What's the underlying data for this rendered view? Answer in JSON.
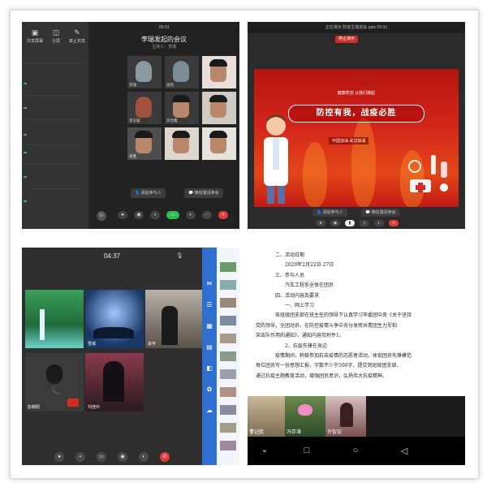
{
  "panel1": {
    "toolbar": [
      {
        "label": "共享屏幕"
      },
      {
        "label": "分屏"
      },
      {
        "label": "禁止共享"
      }
    ],
    "time": "05:03",
    "meeting_title": "李瑞发起的会议",
    "meeting_sub": "主持人：李瑞",
    "participants": [
      {
        "name": "李瑞"
      },
      {
        "name": "张凯"
      },
      {
        "name": "陈子良"
      },
      {
        "name": "李玉璇"
      },
      {
        "name": "邓佳鑫"
      },
      {
        "name": "王浩"
      },
      {
        "name": "黄鑫"
      },
      {
        "name": "刘阳"
      },
      {
        "name": "张宇"
      }
    ],
    "add_participant_label": "添加参与人",
    "invite_label": "微信邀请参会"
  },
  "panel2": {
    "window_title": "正在演示 防疫主题班会.pptx 05:03",
    "tag": "停止演示",
    "slogan_top": "健康防范 从我们做起",
    "headline": "防控有我，战疫必胜",
    "footer_text": "中国加油 武汉加油",
    "add_participant_label": "添加参与人",
    "invite_label": "微信邀请参会"
  },
  "panel3": {
    "time": "04:37",
    "tiles": [
      {
        "name": "",
        "color": "#2f8a4c"
      },
      {
        "name": "雪域",
        "color": "#1d3a6a"
      },
      {
        "name": "肖宇",
        "color": "#5a5148"
      },
      {
        "name": "彭朝阳",
        "color": "#3a3a3a"
      },
      {
        "name": "刘佳玲",
        "color": "#4a2a3a"
      }
    ]
  },
  "panel4": {
    "lines": [
      "二、活动日期",
      "2020年2月22日-27日",
      "三、参与人员",
      "汽车工程系全体在团员",
      "四、活动内容及要求",
      "一、网上学习",
      "各班级团支部在班主任的领导下认真学习市委团中央《关于坚持",
      "党的领导，全团动员，在防控疫情斗争中充分发挥共青团生力军和",
      "突击队作用的通知》，通知内容见附件1。",
      "2、抗疫先锋在身边",
      "疫情期间，积极参加抗击疫情的志愿者活动，体现团员先锋模范",
      "每位团员写一份思想汇报，字数不少于500字，提交到班级团支部，",
      "通过抗疫主题教育活动，增强团员意识，弘扬伟大抗疫精神。"
    ],
    "strip": [
      {
        "name": "曹记胜"
      },
      {
        "name": "冯存涛"
      },
      {
        "name": "许智宏"
      }
    ]
  }
}
